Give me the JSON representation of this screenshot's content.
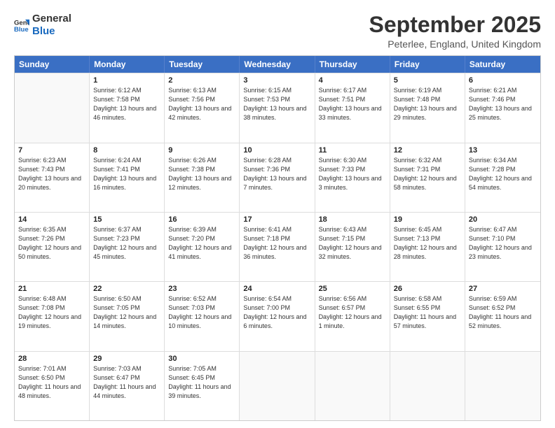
{
  "logo": {
    "line1": "General",
    "line2": "Blue"
  },
  "title": "September 2025",
  "subtitle": "Peterlee, England, United Kingdom",
  "days": [
    "Sunday",
    "Monday",
    "Tuesday",
    "Wednesday",
    "Thursday",
    "Friday",
    "Saturday"
  ],
  "weeks": [
    [
      {
        "day": "",
        "sunrise": "",
        "sunset": "",
        "daylight": ""
      },
      {
        "day": "1",
        "sunrise": "6:12 AM",
        "sunset": "7:58 PM",
        "daylight": "13 hours and 46 minutes."
      },
      {
        "day": "2",
        "sunrise": "6:13 AM",
        "sunset": "7:56 PM",
        "daylight": "13 hours and 42 minutes."
      },
      {
        "day": "3",
        "sunrise": "6:15 AM",
        "sunset": "7:53 PM",
        "daylight": "13 hours and 38 minutes."
      },
      {
        "day": "4",
        "sunrise": "6:17 AM",
        "sunset": "7:51 PM",
        "daylight": "13 hours and 33 minutes."
      },
      {
        "day": "5",
        "sunrise": "6:19 AM",
        "sunset": "7:48 PM",
        "daylight": "13 hours and 29 minutes."
      },
      {
        "day": "6",
        "sunrise": "6:21 AM",
        "sunset": "7:46 PM",
        "daylight": "13 hours and 25 minutes."
      }
    ],
    [
      {
        "day": "7",
        "sunrise": "6:23 AM",
        "sunset": "7:43 PM",
        "daylight": "13 hours and 20 minutes."
      },
      {
        "day": "8",
        "sunrise": "6:24 AM",
        "sunset": "7:41 PM",
        "daylight": "13 hours and 16 minutes."
      },
      {
        "day": "9",
        "sunrise": "6:26 AM",
        "sunset": "7:38 PM",
        "daylight": "13 hours and 12 minutes."
      },
      {
        "day": "10",
        "sunrise": "6:28 AM",
        "sunset": "7:36 PM",
        "daylight": "13 hours and 7 minutes."
      },
      {
        "day": "11",
        "sunrise": "6:30 AM",
        "sunset": "7:33 PM",
        "daylight": "13 hours and 3 minutes."
      },
      {
        "day": "12",
        "sunrise": "6:32 AM",
        "sunset": "7:31 PM",
        "daylight": "12 hours and 58 minutes."
      },
      {
        "day": "13",
        "sunrise": "6:34 AM",
        "sunset": "7:28 PM",
        "daylight": "12 hours and 54 minutes."
      }
    ],
    [
      {
        "day": "14",
        "sunrise": "6:35 AM",
        "sunset": "7:26 PM",
        "daylight": "12 hours and 50 minutes."
      },
      {
        "day": "15",
        "sunrise": "6:37 AM",
        "sunset": "7:23 PM",
        "daylight": "12 hours and 45 minutes."
      },
      {
        "day": "16",
        "sunrise": "6:39 AM",
        "sunset": "7:20 PM",
        "daylight": "12 hours and 41 minutes."
      },
      {
        "day": "17",
        "sunrise": "6:41 AM",
        "sunset": "7:18 PM",
        "daylight": "12 hours and 36 minutes."
      },
      {
        "day": "18",
        "sunrise": "6:43 AM",
        "sunset": "7:15 PM",
        "daylight": "12 hours and 32 minutes."
      },
      {
        "day": "19",
        "sunrise": "6:45 AM",
        "sunset": "7:13 PM",
        "daylight": "12 hours and 28 minutes."
      },
      {
        "day": "20",
        "sunrise": "6:47 AM",
        "sunset": "7:10 PM",
        "daylight": "12 hours and 23 minutes."
      }
    ],
    [
      {
        "day": "21",
        "sunrise": "6:48 AM",
        "sunset": "7:08 PM",
        "daylight": "12 hours and 19 minutes."
      },
      {
        "day": "22",
        "sunrise": "6:50 AM",
        "sunset": "7:05 PM",
        "daylight": "12 hours and 14 minutes."
      },
      {
        "day": "23",
        "sunrise": "6:52 AM",
        "sunset": "7:03 PM",
        "daylight": "12 hours and 10 minutes."
      },
      {
        "day": "24",
        "sunrise": "6:54 AM",
        "sunset": "7:00 PM",
        "daylight": "12 hours and 6 minutes."
      },
      {
        "day": "25",
        "sunrise": "6:56 AM",
        "sunset": "6:57 PM",
        "daylight": "12 hours and 1 minute."
      },
      {
        "day": "26",
        "sunrise": "6:58 AM",
        "sunset": "6:55 PM",
        "daylight": "11 hours and 57 minutes."
      },
      {
        "day": "27",
        "sunrise": "6:59 AM",
        "sunset": "6:52 PM",
        "daylight": "11 hours and 52 minutes."
      }
    ],
    [
      {
        "day": "28",
        "sunrise": "7:01 AM",
        "sunset": "6:50 PM",
        "daylight": "11 hours and 48 minutes."
      },
      {
        "day": "29",
        "sunrise": "7:03 AM",
        "sunset": "6:47 PM",
        "daylight": "11 hours and 44 minutes."
      },
      {
        "day": "30",
        "sunrise": "7:05 AM",
        "sunset": "6:45 PM",
        "daylight": "11 hours and 39 minutes."
      },
      {
        "day": "",
        "sunrise": "",
        "sunset": "",
        "daylight": ""
      },
      {
        "day": "",
        "sunrise": "",
        "sunset": "",
        "daylight": ""
      },
      {
        "day": "",
        "sunrise": "",
        "sunset": "",
        "daylight": ""
      },
      {
        "day": "",
        "sunrise": "",
        "sunset": "",
        "daylight": ""
      }
    ]
  ],
  "labels": {
    "sunrise": "Sunrise:",
    "sunset": "Sunset:",
    "daylight": "Daylight:"
  }
}
